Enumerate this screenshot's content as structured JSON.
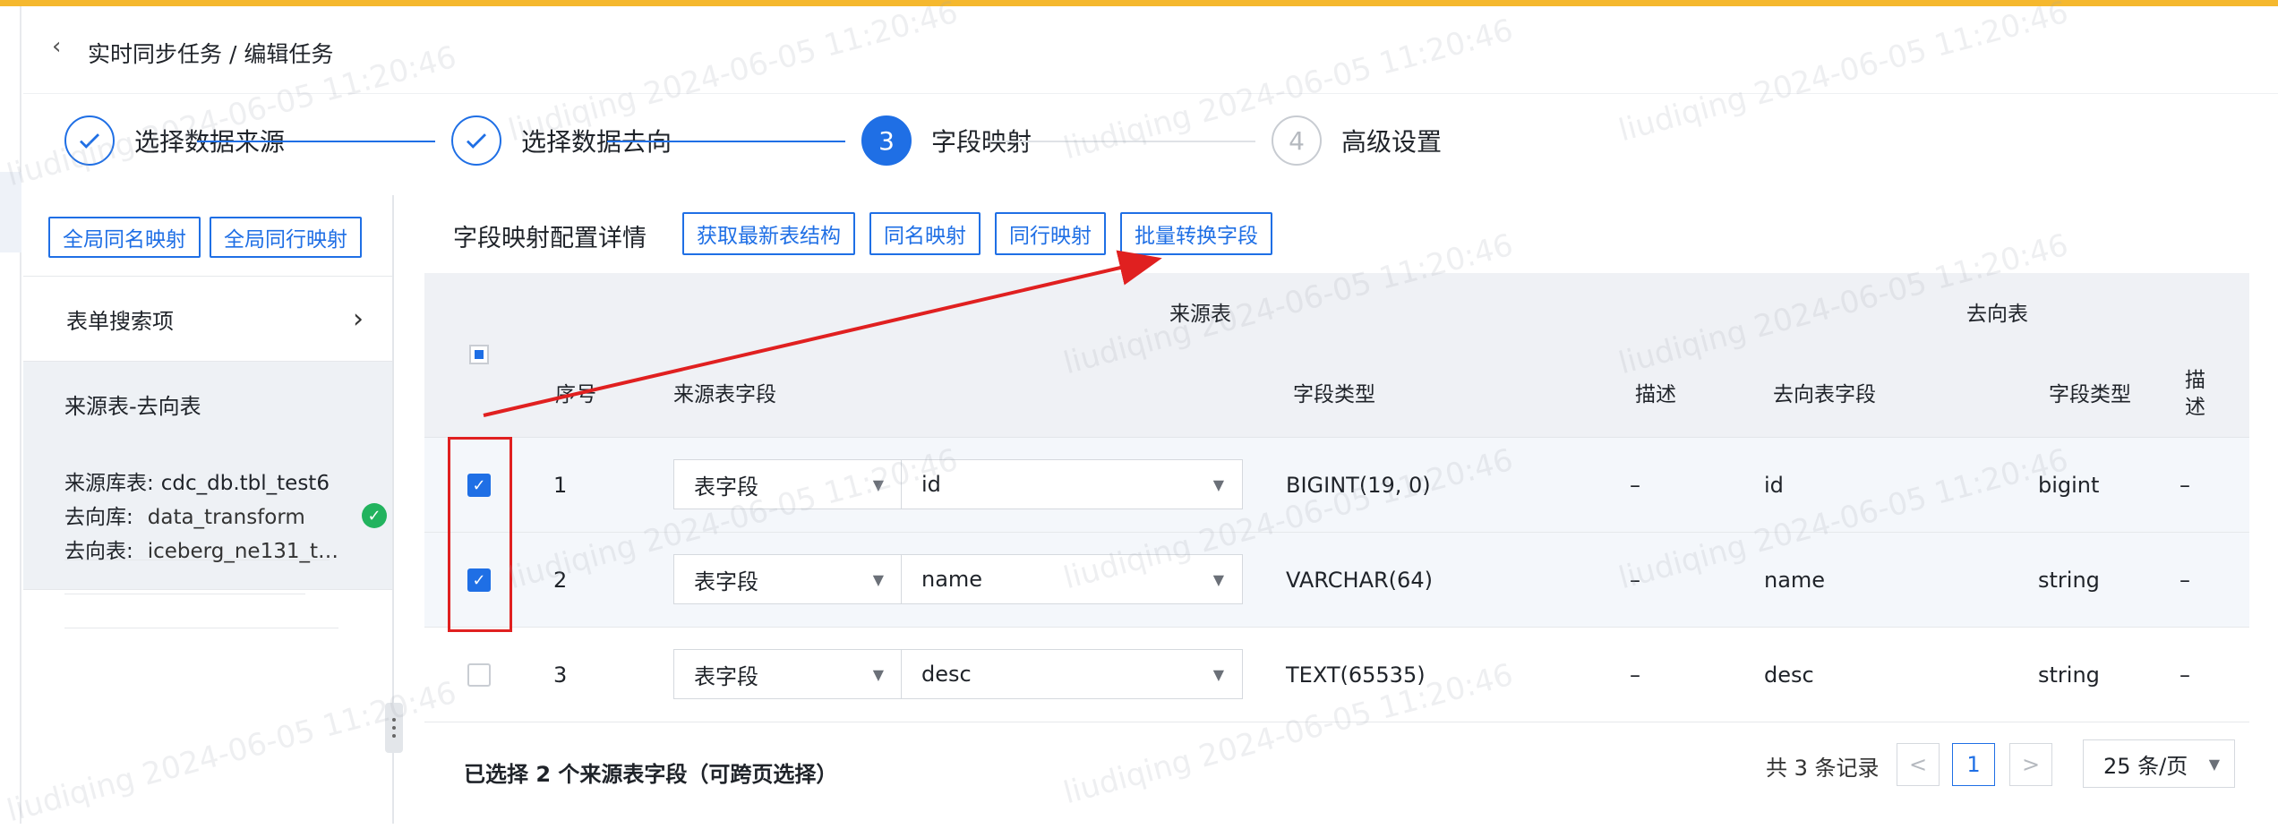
{
  "header": {
    "breadcrumb": "实时同步任务 / 编辑任务"
  },
  "steps": [
    {
      "label": "选择数据来源",
      "status": "done"
    },
    {
      "label": "选择数据去向",
      "status": "done"
    },
    {
      "number": "3",
      "label": "字段映射",
      "status": "active"
    },
    {
      "number": "4",
      "label": "高级设置",
      "status": "todo"
    }
  ],
  "sidebar": {
    "global_same_name": "全局同名映射",
    "global_same_row": "全局同行映射",
    "search_label": "表单搜索项",
    "panel_title": "来源表-去向表",
    "source_label": "来源库表:",
    "source_value": "cdc_db.tbl_test6",
    "target_db_label": "去向库:",
    "target_db_value": "data_transform",
    "target_table_label": "去向表:",
    "target_table_value": "iceberg_ne131_t…"
  },
  "main": {
    "title": "字段映射配置详情",
    "toolbar": {
      "fetch": "获取最新表结构",
      "same_name": "同名映射",
      "same_row": "同行映射",
      "batch": "批量转换字段"
    }
  },
  "table": {
    "group_source": "来源表",
    "group_target": "去向表",
    "headers": {
      "index": "序号",
      "source_field": "来源表字段",
      "field_type": "字段类型",
      "desc": "描述",
      "target_field": "去向表字段",
      "target_type": "字段类型",
      "target_desc_1": "描",
      "target_desc_2": "述"
    },
    "rows": [
      {
        "checked": true,
        "index": "1",
        "kind": "表字段",
        "field": "id",
        "type": "BIGINT(19, 0)",
        "desc": "–",
        "target_field": "id",
        "target_type": "bigint",
        "target_desc": "–"
      },
      {
        "checked": true,
        "index": "2",
        "kind": "表字段",
        "field": "name",
        "type": "VARCHAR(64)",
        "desc": "–",
        "target_field": "name",
        "target_type": "string",
        "target_desc": "–"
      },
      {
        "checked": false,
        "index": "3",
        "kind": "表字段",
        "field": "desc",
        "type": "TEXT(65535)",
        "desc": "–",
        "target_field": "desc",
        "target_type": "string",
        "target_desc": "–"
      }
    ]
  },
  "footer": {
    "selected": "已选择 2 个来源表字段（可跨页选择）",
    "total": "共 3 条记录",
    "prev": "<",
    "page": "1",
    "next": ">",
    "page_size": "25 条/页"
  },
  "watermark": "liudiqing 2024-06-05 11:20:46",
  "colors": {
    "primary": "#1f6fe5",
    "top_bar": "#f5b82e",
    "annotation": "#e02020",
    "success": "#22b35e"
  }
}
